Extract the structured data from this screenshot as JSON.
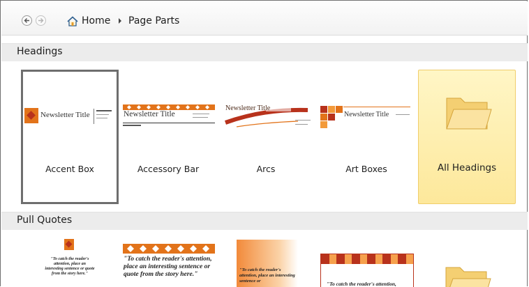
{
  "nav": {
    "home_label": "Home",
    "page_label": "Page Parts",
    "back_icon": "back-arrow-icon",
    "forward_icon": "forward-arrow-icon"
  },
  "sections": {
    "headings_title": "Headings",
    "pull_quotes_title": "Pull Quotes"
  },
  "headings": [
    {
      "label": "Accent Box",
      "preview_title": "Newsletter Title",
      "selected": true
    },
    {
      "label": "Accessory Bar",
      "preview_title": "Newsletter Title"
    },
    {
      "label": "Arcs",
      "preview_title": "Newsletter Title"
    },
    {
      "label": "Art Boxes",
      "preview_title": "Newsletter Title"
    },
    {
      "label": "All Headings",
      "icon": "folder-icon"
    }
  ],
  "pull_quotes": [
    {
      "preview_text": "\"To catch the reader's attention, place an interesting sentence or quote from the story here.\""
    },
    {
      "preview_text": "\"To catch the reader's attention, place an interesting sentence or quote from the story here.\""
    },
    {
      "preview_text": "\"To catch the reader's attention, place an interesting sentence or"
    },
    {
      "preview_text": "\"To catch the reader's attention,"
    }
  ],
  "colors": {
    "accent_orange": "#e2731a",
    "accent_red": "#b8321c",
    "folder_fill": "#fde89b",
    "selection_border": "#6e6e6e"
  }
}
